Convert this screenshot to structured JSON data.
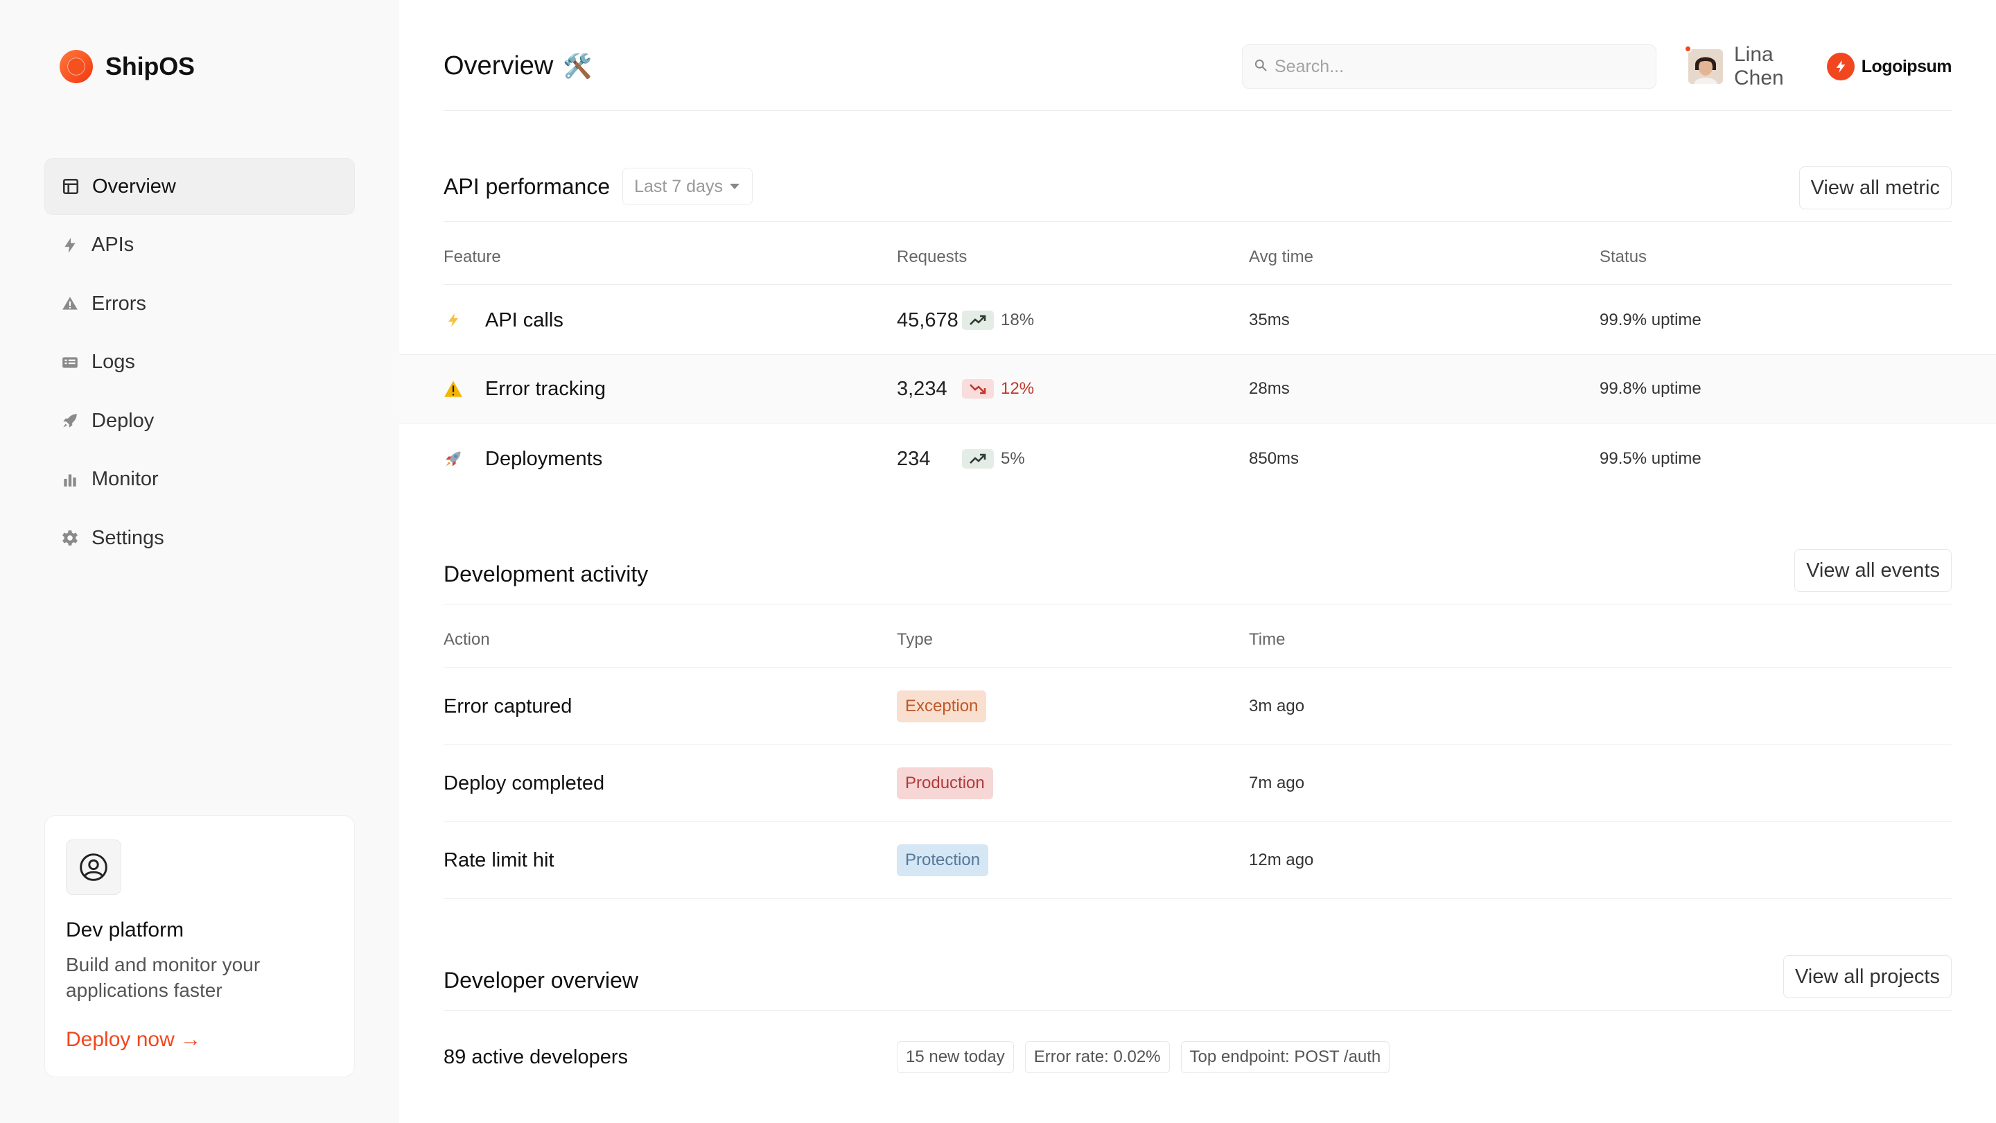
{
  "brand": {
    "name": "ShipOS"
  },
  "nav": [
    {
      "label": "Overview",
      "icon": "layout-icon",
      "active": true
    },
    {
      "label": "APIs",
      "icon": "bolt-icon"
    },
    {
      "label": "Errors",
      "icon": "warning-icon"
    },
    {
      "label": "Logs",
      "icon": "list-icon"
    },
    {
      "label": "Deploy",
      "icon": "rocket-icon"
    },
    {
      "label": "Monitor",
      "icon": "bar-chart-icon"
    },
    {
      "label": "Settings",
      "icon": "gear-icon"
    }
  ],
  "promo": {
    "title": "Dev platform",
    "text": "Build and monitor your applications faster",
    "cta": "Deploy now →"
  },
  "header": {
    "title": "Overview",
    "title_emoji": "🛠️",
    "search_placeholder": "Search...",
    "user_name": "Lina Chen",
    "partner_name": "Logoipsum"
  },
  "api": {
    "title": "API performance",
    "range": "Last 7 days",
    "view_all": "View all metric",
    "columns": [
      "Feature",
      "Requests",
      "Avg time",
      "Status"
    ],
    "rows": [
      {
        "icon": "bolt-icon",
        "feature": "API calls",
        "requests": "45,678",
        "trend": "up",
        "pct": "18%",
        "avg": "35ms",
        "status": "99.9% uptime"
      },
      {
        "icon": "warning-icon",
        "feature": "Error tracking",
        "requests": "3,234",
        "trend": "down",
        "pct": "12%",
        "avg": "28ms",
        "status": "99.8% uptime"
      },
      {
        "icon": "rocket-icon",
        "feature": "Deployments",
        "requests": "234",
        "trend": "up",
        "pct": "5%",
        "avg": "850ms",
        "status": "99.5% uptime"
      }
    ]
  },
  "activity": {
    "title": "Development activity",
    "view_all": "View all events",
    "columns": [
      "Action",
      "Type",
      "Time"
    ],
    "rows": [
      {
        "action": "Error captured",
        "type": "Exception",
        "type_bg": "#f9dfcf",
        "type_color": "#c0582a",
        "time": "3m ago"
      },
      {
        "action": "Deploy completed",
        "type": "Production",
        "type_bg": "#f7d6d6",
        "type_color": "#b23a3a",
        "time": "7m ago"
      },
      {
        "action": "Rate limit hit",
        "type": "Protection",
        "type_bg": "#d5e6f4",
        "type_color": "#55789a",
        "time": "12m ago"
      }
    ]
  },
  "developer": {
    "title": "Developer overview",
    "view_all": "View all projects",
    "summary": "89 active developers",
    "chips": [
      "15 new today",
      "Error rate: 0.02%",
      "Top endpoint: POST /auth"
    ]
  },
  "colors": {
    "accent": "#f2461e",
    "sidebar_bg": "#f9f9f9"
  }
}
